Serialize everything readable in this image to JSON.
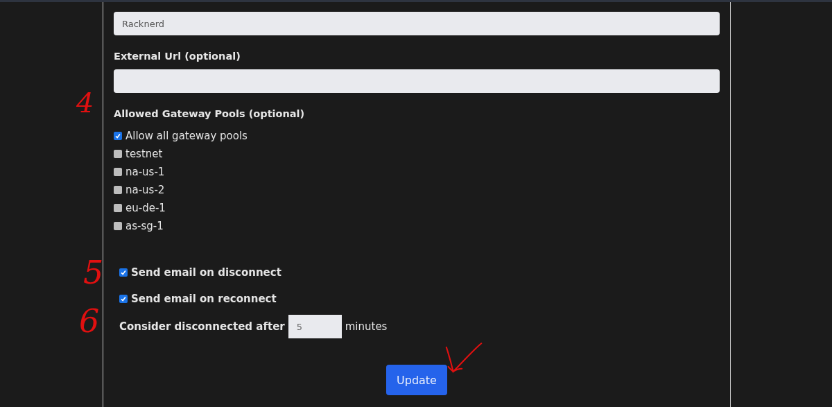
{
  "name_field": {
    "value": "Racknerd"
  },
  "external_url": {
    "label": "External Url (optional)"
  },
  "gateway_pools": {
    "label": "Allowed Gateway Pools (optional)",
    "annotation": "4",
    "options": [
      {
        "label": "Allow all gateway pools",
        "checked": true
      },
      {
        "label": "testnet",
        "checked": false
      },
      {
        "label": "na-us-1",
        "checked": false
      },
      {
        "label": "na-us-2",
        "checked": false
      },
      {
        "label": "eu-de-1",
        "checked": false
      },
      {
        "label": "as-sg-1",
        "checked": false
      }
    ]
  },
  "notifications": {
    "annotation": "5",
    "options": [
      {
        "label": "Send email on disconnect",
        "checked": true
      },
      {
        "label": "Send email on reconnect",
        "checked": true
      }
    ]
  },
  "disconnect_timeout": {
    "label": "Consider disconnected after",
    "value": "5",
    "unit": "minutes",
    "annotation": "6"
  },
  "submit_button": {
    "label": "Update",
    "annotation": {
      "kind": "checkmark"
    }
  }
}
